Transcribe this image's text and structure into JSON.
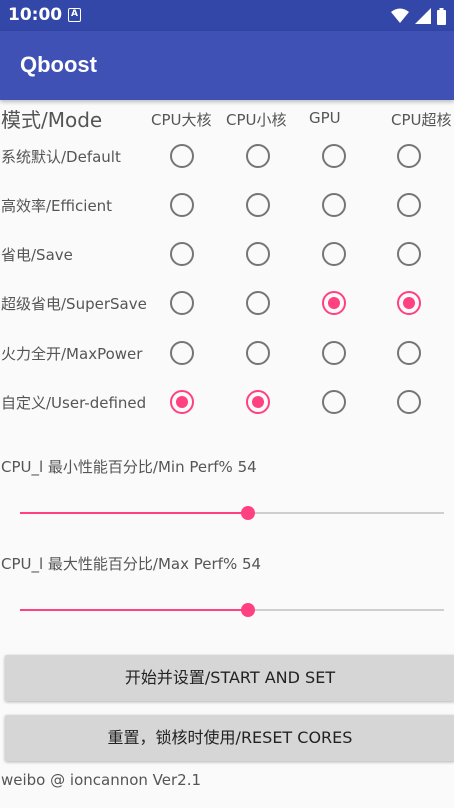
{
  "status_bar": {
    "time": "10:00",
    "notification_icon": "A"
  },
  "app": {
    "title": "Qboost"
  },
  "grid": {
    "mode_heading": "模式/Mode",
    "columns": [
      "CPU大核",
      "CPU小核",
      "GPU",
      "CPU超核"
    ],
    "rows": [
      {
        "label": "系统默认/Default",
        "checked": [
          false,
          false,
          false,
          false
        ]
      },
      {
        "label": "高效率/Efficient",
        "checked": [
          false,
          false,
          false,
          false
        ]
      },
      {
        "label": "省电/Save",
        "checked": [
          false,
          false,
          false,
          false
        ]
      },
      {
        "label": "超级省电/SuperSave",
        "checked": [
          false,
          false,
          true,
          true
        ]
      },
      {
        "label": "火力全开/MaxPower",
        "checked": [
          false,
          false,
          false,
          false
        ]
      },
      {
        "label": "自定义/User-defined",
        "checked": [
          true,
          true,
          false,
          false
        ]
      }
    ]
  },
  "sliders": [
    {
      "label": "CPU_l 最小性能百分比/Min Perf% 54",
      "value_percent": 54
    },
    {
      "label": "CPU_l 最大性能百分比/Max Perf% 54",
      "value_percent": 54
    }
  ],
  "buttons": {
    "start": "开始并设置/START AND SET",
    "reset": "重置，锁核时使用/RESET CORES"
  },
  "footer": "weibo @ ioncannon Ver2.1",
  "colors": {
    "primary": "#3f51b5",
    "primary_dark": "#3347a8",
    "accent": "#ff4081"
  }
}
